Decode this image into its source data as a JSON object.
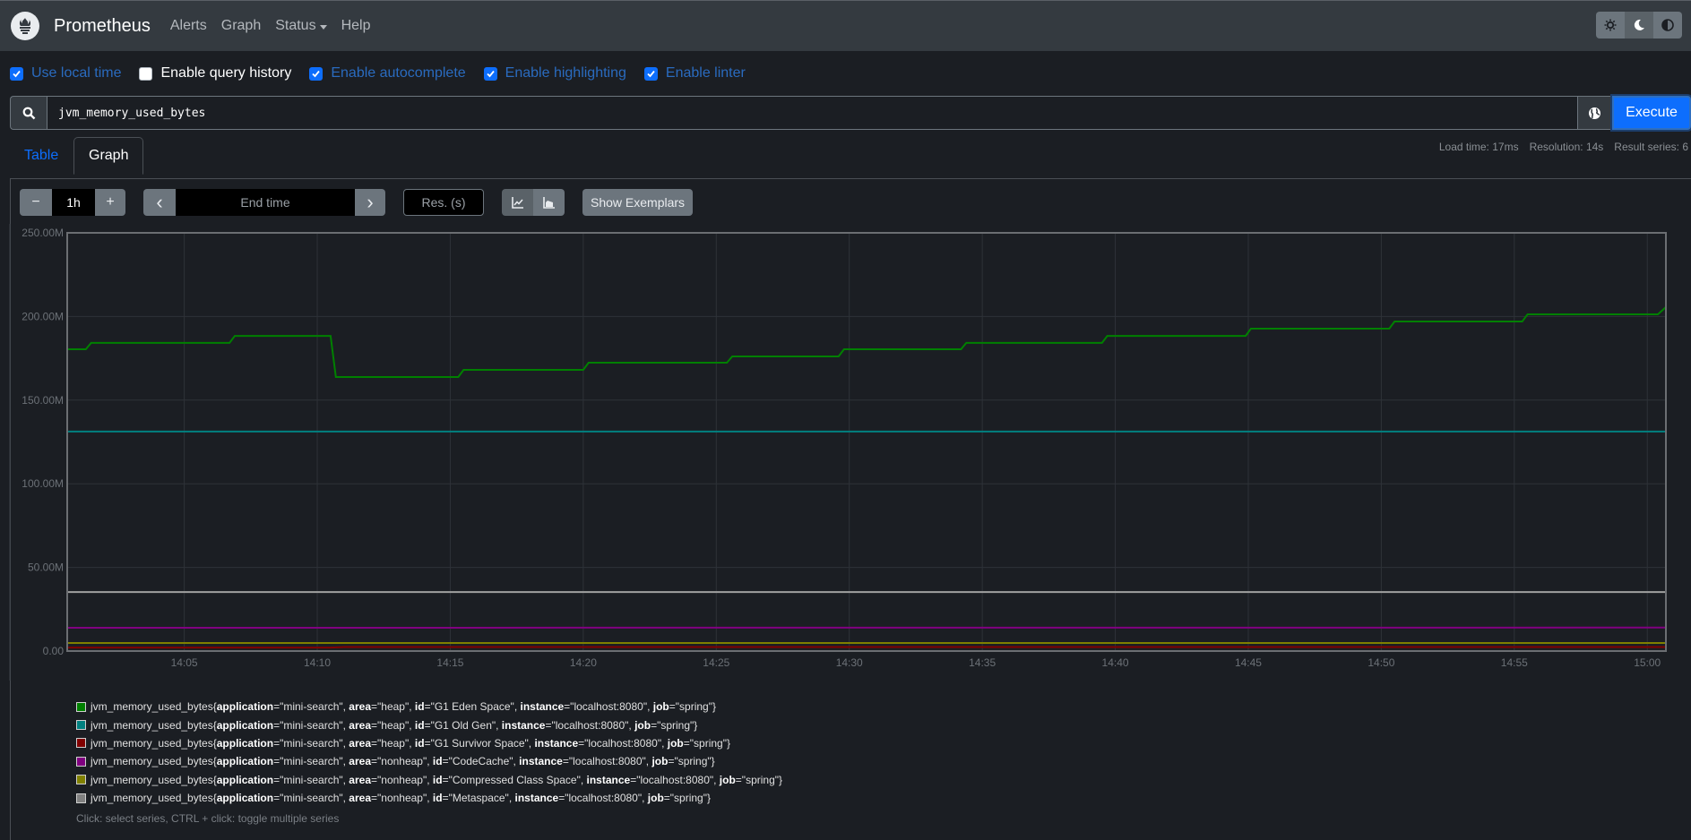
{
  "navbar": {
    "brand": "Prometheus",
    "links": [
      {
        "label": "Alerts"
      },
      {
        "label": "Graph"
      },
      {
        "label": "Status",
        "dropdown": true
      },
      {
        "label": "Help"
      }
    ],
    "theme_buttons": [
      {
        "icon": "sun-icon",
        "active": false
      },
      {
        "icon": "moon-icon",
        "active": true
      },
      {
        "icon": "contrast-icon",
        "active": false
      }
    ]
  },
  "options": [
    {
      "label": "Use local time",
      "checked": true
    },
    {
      "label": "Enable query history",
      "checked": false
    },
    {
      "label": "Enable autocomplete",
      "checked": true
    },
    {
      "label": "Enable highlighting",
      "checked": true
    },
    {
      "label": "Enable linter",
      "checked": true
    }
  ],
  "query": {
    "value": "jvm_memory_used_bytes",
    "execute_label": "Execute"
  },
  "tabs": {
    "table": "Table",
    "graph": "Graph",
    "active": "Graph"
  },
  "stats": {
    "load_time": "Load time: 17ms",
    "resolution": "Resolution: 14s",
    "result_series": "Result series: 6"
  },
  "controls": {
    "minus": "−",
    "range": "1h",
    "plus": "+",
    "prev": "‹",
    "end_time_placeholder": "End time",
    "next": "›",
    "resolution_placeholder": "Res. (s)",
    "stacked_mode": "lines",
    "show_exemplars": "Show Exemplars"
  },
  "chart_data": {
    "type": "line",
    "title": "",
    "xlabel": "",
    "ylabel": "",
    "ylim": [
      0,
      250000000
    ],
    "xlim_minutes": [
      0.6,
      60.7
    ],
    "y_ticks": [
      {
        "value": 0,
        "label": "0.00"
      },
      {
        "value": 50000000,
        "label": "50.00M"
      },
      {
        "value": 100000000,
        "label": "100.00M"
      },
      {
        "value": 150000000,
        "label": "150.00M"
      },
      {
        "value": 200000000,
        "label": "200.00M"
      },
      {
        "value": 250000000,
        "label": "250.00M"
      }
    ],
    "x_ticks": [
      {
        "minute": 5,
        "label": "14:05"
      },
      {
        "minute": 10,
        "label": "14:10"
      },
      {
        "minute": 15,
        "label": "14:15"
      },
      {
        "minute": 20,
        "label": "14:20"
      },
      {
        "minute": 25,
        "label": "14:25"
      },
      {
        "minute": 30,
        "label": "14:30"
      },
      {
        "minute": 35,
        "label": "14:35"
      },
      {
        "minute": 40,
        "label": "14:40"
      },
      {
        "minute": 45,
        "label": "14:45"
      },
      {
        "minute": 50,
        "label": "14:50"
      },
      {
        "minute": 55,
        "label": "14:55"
      },
      {
        "minute": 60,
        "label": "15:00"
      }
    ],
    "grid": true,
    "x_unit": "minutes after 14:00",
    "series": [
      {
        "name": "G1 Eden Space",
        "color": "#008000",
        "points": [
          [
            0.6,
            180.4
          ],
          [
            1.3,
            180.4
          ],
          [
            1.5,
            184.2
          ],
          [
            6.7,
            184.2
          ],
          [
            6.9,
            188.4
          ],
          [
            10.5,
            188.4
          ],
          [
            10.7,
            163.8
          ],
          [
            15.3,
            163.8
          ],
          [
            15.5,
            168.1
          ],
          [
            20.0,
            168.1
          ],
          [
            20.2,
            172.4
          ],
          [
            25.4,
            172.4
          ],
          [
            25.6,
            176.1
          ],
          [
            29.6,
            176.1
          ],
          [
            29.8,
            180.4
          ],
          [
            34.2,
            180.4
          ],
          [
            34.4,
            184.2
          ],
          [
            39.5,
            184.2
          ],
          [
            39.7,
            188.4
          ],
          [
            44.9,
            188.4
          ],
          [
            45.1,
            192.7
          ],
          [
            50.3,
            192.7
          ],
          [
            50.5,
            197.0
          ],
          [
            55.3,
            197.0
          ],
          [
            55.5,
            201.3
          ],
          [
            60.4,
            201.3
          ],
          [
            60.7,
            205.6
          ]
        ]
      },
      {
        "name": "G1 Old Gen",
        "color": "#008080",
        "points": [
          [
            0.6,
            131.2
          ],
          [
            60.7,
            131.2
          ]
        ]
      },
      {
        "name": "G1 Survivor Space",
        "color": "#800000",
        "points": [
          [
            0.6,
            2.1
          ],
          [
            10.5,
            2.1
          ],
          [
            11.0,
            2.4
          ],
          [
            60.7,
            2.4
          ]
        ]
      },
      {
        "name": "CodeCache",
        "color": "#800080",
        "points": [
          [
            0.6,
            13.9
          ],
          [
            60.7,
            14.0
          ]
        ]
      },
      {
        "name": "Compressed Class Space",
        "color": "#808000",
        "points": [
          [
            0.6,
            4.8
          ],
          [
            60.7,
            4.8
          ]
        ]
      },
      {
        "name": "Metaspace",
        "color": "#a0a0a0",
        "points": [
          [
            0.6,
            35.3
          ],
          [
            60.7,
            35.3
          ]
        ]
      }
    ],
    "y_unit": "millions of bytes"
  },
  "legend": {
    "metric": "jvm_memory_used_bytes",
    "items": [
      {
        "color": "#008000",
        "labels": [
          [
            "application",
            "mini-search"
          ],
          [
            "area",
            "heap"
          ],
          [
            "id",
            "G1 Eden Space"
          ],
          [
            "instance",
            "localhost:8080"
          ],
          [
            "job",
            "spring"
          ]
        ]
      },
      {
        "color": "#008080",
        "labels": [
          [
            "application",
            "mini-search"
          ],
          [
            "area",
            "heap"
          ],
          [
            "id",
            "G1 Old Gen"
          ],
          [
            "instance",
            "localhost:8080"
          ],
          [
            "job",
            "spring"
          ]
        ]
      },
      {
        "color": "#800000",
        "labels": [
          [
            "application",
            "mini-search"
          ],
          [
            "area",
            "heap"
          ],
          [
            "id",
            "G1 Survivor Space"
          ],
          [
            "instance",
            "localhost:8080"
          ],
          [
            "job",
            "spring"
          ]
        ]
      },
      {
        "color": "#800080",
        "labels": [
          [
            "application",
            "mini-search"
          ],
          [
            "area",
            "nonheap"
          ],
          [
            "id",
            "CodeCache"
          ],
          [
            "instance",
            "localhost:8080"
          ],
          [
            "job",
            "spring"
          ]
        ]
      },
      {
        "color": "#808000",
        "labels": [
          [
            "application",
            "mini-search"
          ],
          [
            "area",
            "nonheap"
          ],
          [
            "id",
            "Compressed Class Space"
          ],
          [
            "instance",
            "localhost:8080"
          ],
          [
            "job",
            "spring"
          ]
        ]
      },
      {
        "color": "#808080",
        "labels": [
          [
            "application",
            "mini-search"
          ],
          [
            "area",
            "nonheap"
          ],
          [
            "id",
            "Metaspace"
          ],
          [
            "instance",
            "localhost:8080"
          ],
          [
            "job",
            "spring"
          ]
        ]
      }
    ],
    "hint": "Click: select series, CTRL + click: toggle multiple series"
  }
}
